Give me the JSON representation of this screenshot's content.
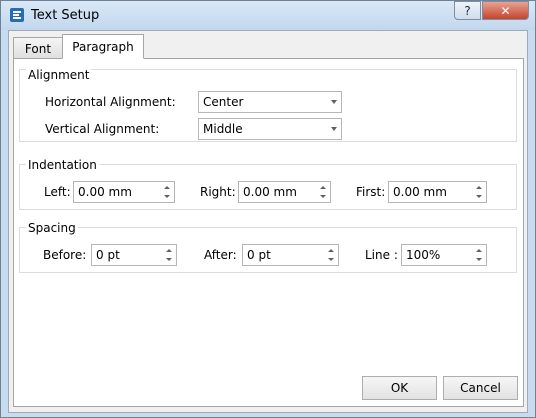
{
  "window": {
    "title": "Text Setup",
    "help_glyph": "?",
    "close_glyph": "✕"
  },
  "tabs": [
    {
      "label": "Font"
    },
    {
      "label": "Paragraph"
    }
  ],
  "alignment": {
    "title": "Alignment",
    "horizontal": {
      "label": "Horizontal Alignment:",
      "value": "Center"
    },
    "vertical": {
      "label": "Vertical Alignment:",
      "value": "Middle"
    }
  },
  "indentation": {
    "title": "Indentation",
    "left": {
      "label": "Left:",
      "value": "0.00 mm"
    },
    "right": {
      "label": "Right:",
      "value": "0.00 mm"
    },
    "first": {
      "label": "First:",
      "value": "0.00 mm"
    }
  },
  "spacing": {
    "title": "Spacing",
    "before": {
      "label": "Before:",
      "value": "0 pt"
    },
    "after": {
      "label": "After:",
      "value": "0 pt"
    },
    "line": {
      "label": "Line :",
      "value": "100%"
    }
  },
  "buttons": {
    "ok": "OK",
    "cancel": "Cancel"
  }
}
